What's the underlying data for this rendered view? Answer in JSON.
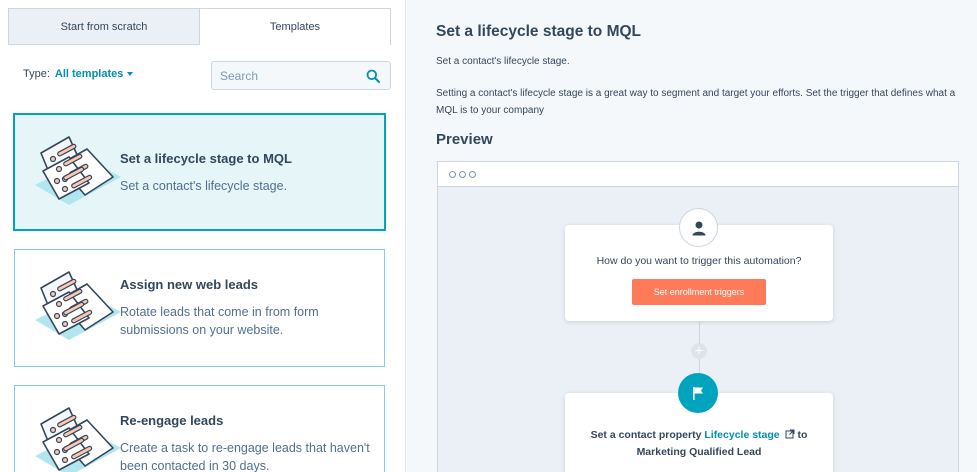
{
  "tabs": [
    {
      "label": "Start from scratch",
      "active": false
    },
    {
      "label": "Templates",
      "active": true
    }
  ],
  "filter": {
    "label": "Type:",
    "value": "All templates"
  },
  "search": {
    "placeholder": "Search"
  },
  "templates": [
    {
      "title": "Set a lifecycle stage to MQL",
      "description": "Set a contact's lifecycle stage.",
      "selected": true
    },
    {
      "title": "Assign new web leads",
      "description": "Rotate leads that come in from form submissions on your website.",
      "selected": false
    },
    {
      "title": "Re-engage leads",
      "description": "Create a task to re-engage leads that haven't been contacted in 30 days.",
      "selected": false
    }
  ],
  "detail": {
    "title": "Set a lifecycle stage to MQL",
    "subtitle": "Set a contact's lifecycle stage.",
    "description": "Setting a contact's lifecycle stage is a great way to segment and target your efforts. Set the trigger that defines what a MQL is to your company",
    "preview_label": "Preview",
    "trigger_question": "How do you want to trigger this automation?",
    "trigger_button": "Set enrollment triggers",
    "action_prefix": "Set a contact property ",
    "action_link": "Lifecycle stage",
    "action_to": " to",
    "action_value": "Marketing Qualified Lead"
  },
  "colors": {
    "accent": "#00a4bd",
    "link": "#0091ae",
    "button": "#ff7a59",
    "selected_bg": "#e5f5f8"
  },
  "icons": [
    "search-icon",
    "contact-avatar-icon",
    "flag-icon",
    "external-link-icon",
    "plus-icon",
    "template-illustration"
  ]
}
